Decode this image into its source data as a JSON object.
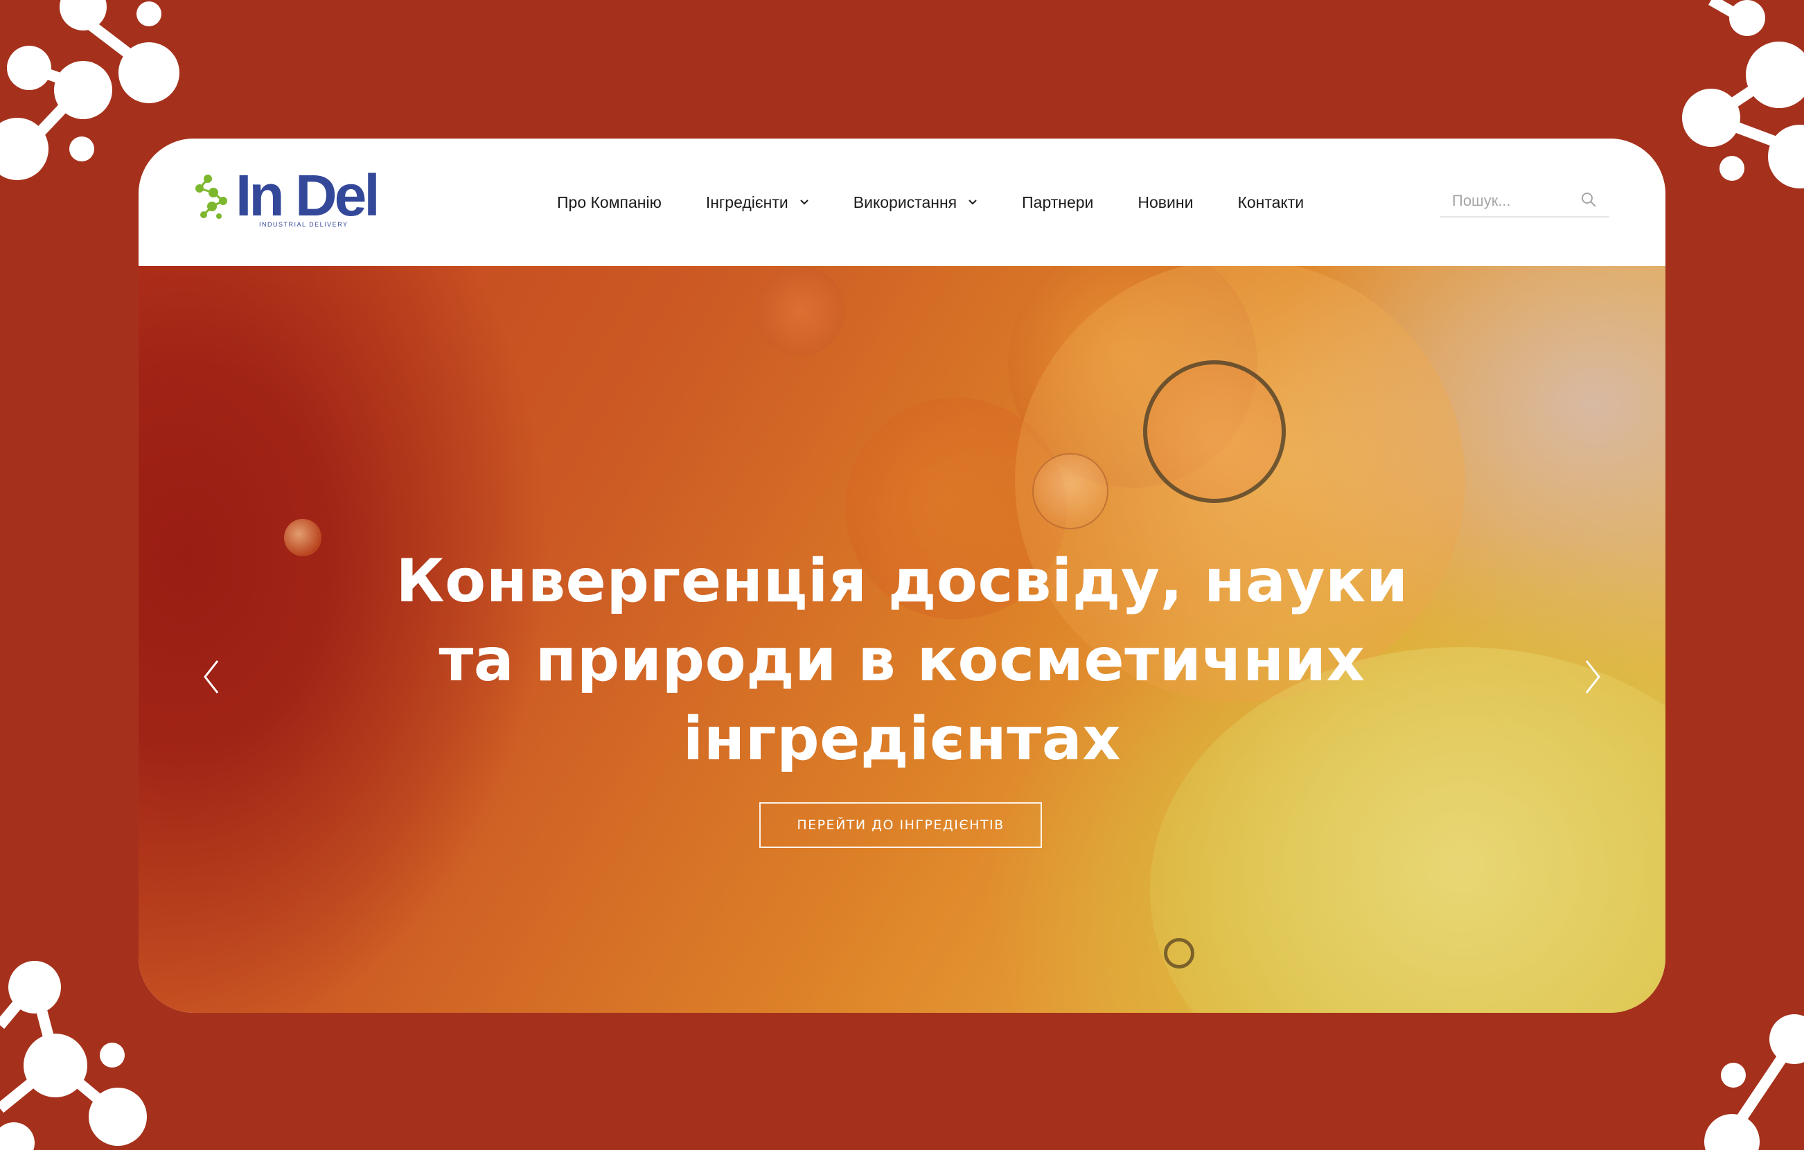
{
  "colors": {
    "background": "#a5311c",
    "brand_blue": "#34489a",
    "brand_green": "#7cb72e",
    "text": "#1c1c1c"
  },
  "logo": {
    "name": "In Del",
    "tagline": "INDUSTRIAL DELIVERY"
  },
  "nav": {
    "items": [
      {
        "label": "Про Компанію",
        "has_dropdown": false
      },
      {
        "label": "Інгредієнти",
        "has_dropdown": true
      },
      {
        "label": "Використання",
        "has_dropdown": true
      },
      {
        "label": "Партнери",
        "has_dropdown": false
      },
      {
        "label": "Новини",
        "has_dropdown": false
      },
      {
        "label": "Контакти",
        "has_dropdown": false
      }
    ]
  },
  "search": {
    "placeholder": "Пошук...",
    "value": ""
  },
  "hero": {
    "title_lines": [
      "Конвергенція досвіду, науки",
      "та природи в косметичних",
      "інгредієнтах"
    ],
    "cta_label": "ПЕРЕЙТИ ДО ІНГРЕДІЄНТІВ"
  },
  "icons": {
    "prev": "chevron-left-icon",
    "next": "chevron-right-icon",
    "search": "search-icon",
    "dropdown": "chevron-down-icon"
  }
}
